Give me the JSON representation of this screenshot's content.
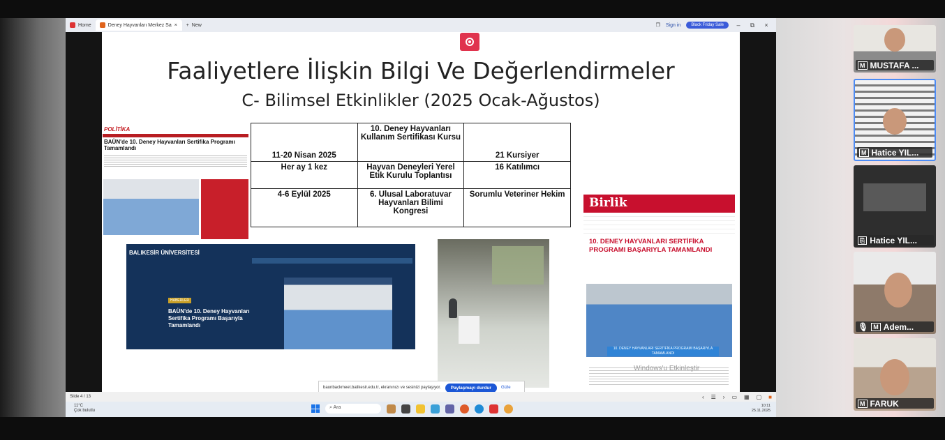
{
  "browser": {
    "home_tab": "Home",
    "active_tab": "Deney Hayvanları Merkez Sa",
    "new_tab": "New",
    "signin": "Sign in",
    "sale": "Black Friday Sale",
    "minimize": "–",
    "restore": "⧉",
    "close": "×"
  },
  "slide": {
    "title": "Faaliyetlere İlişkin Bilgi Ve Değerlendirmeler",
    "subtitle": "C- Bilimsel Etkinlikler (2025 Ocak-Ağustos)",
    "table": [
      [
        "11-20 Nisan 2025",
        "10. Deney Hayvanları Kullanım Sertifikası Kursu",
        "21 Kursiyer"
      ],
      [
        "Her ay 1 kez",
        "Hayvan Deneyleri Yerel Etik Kurulu Toplantısı",
        "16 Katılımcı"
      ],
      [
        "4-6 Eylül 2025",
        "6. Ulusal Laboratuvar Hayvanları Bilimi Kongresi",
        "Sorumlu Veteriner Hekim"
      ]
    ],
    "news1_logo": "POLİTİKA",
    "news1_title": "BAÜN'de 10. Deney Hayvanları Sertifika Programı Tamamlandı",
    "baun_logo": "BALIKESİR ÜNİVERSİTESİ",
    "baun_tag": "HABERLER",
    "baun_headline": "BAÜN'de 10. Deney Hayvanları Sertifika Programı Başarıyla Tamamlandı",
    "birlik_logo": "Birlik",
    "birlik_title": "10. DENEY HAYVANLARI SERTİFİKA PROGRAMI BAŞARIYLA TAMAMLANDI",
    "birlik_banner": "10. DENEY HAYVANLARI SERTİFİKA PROGRAMI BAŞARIYLA TAMAMLANDI",
    "watermark": "Windows'u Etkinleştir"
  },
  "share": {
    "text": "baunbackmeet.balikesir.edu.tr, ekranınızı ve sesinizi paylaşıyor.",
    "stop": "Paylaşmayı durdur",
    "hide": "Gizle"
  },
  "ppt": {
    "slide_counter": "Slide 4 / 13"
  },
  "taskbar": {
    "temp": "11°C",
    "weather": "Çok bulutlu",
    "search": "Ara",
    "time": "10:11",
    "date": "25.11.2025"
  },
  "participants": [
    {
      "badge": "M",
      "name": "MUSTAFA ..."
    },
    {
      "badge": "M",
      "name": "Hatice YIL..."
    },
    {
      "badge": "⎘",
      "name": "Hatice YIL..."
    },
    {
      "badge": "M",
      "name": "Adem..."
    },
    {
      "badge": "M",
      "name": "FARUK"
    }
  ],
  "colors": {
    "record": "#e0334d",
    "share_button": "#1c57d6",
    "birlik_red": "#c8102e",
    "active_speaker": "#4c8bf5"
  }
}
